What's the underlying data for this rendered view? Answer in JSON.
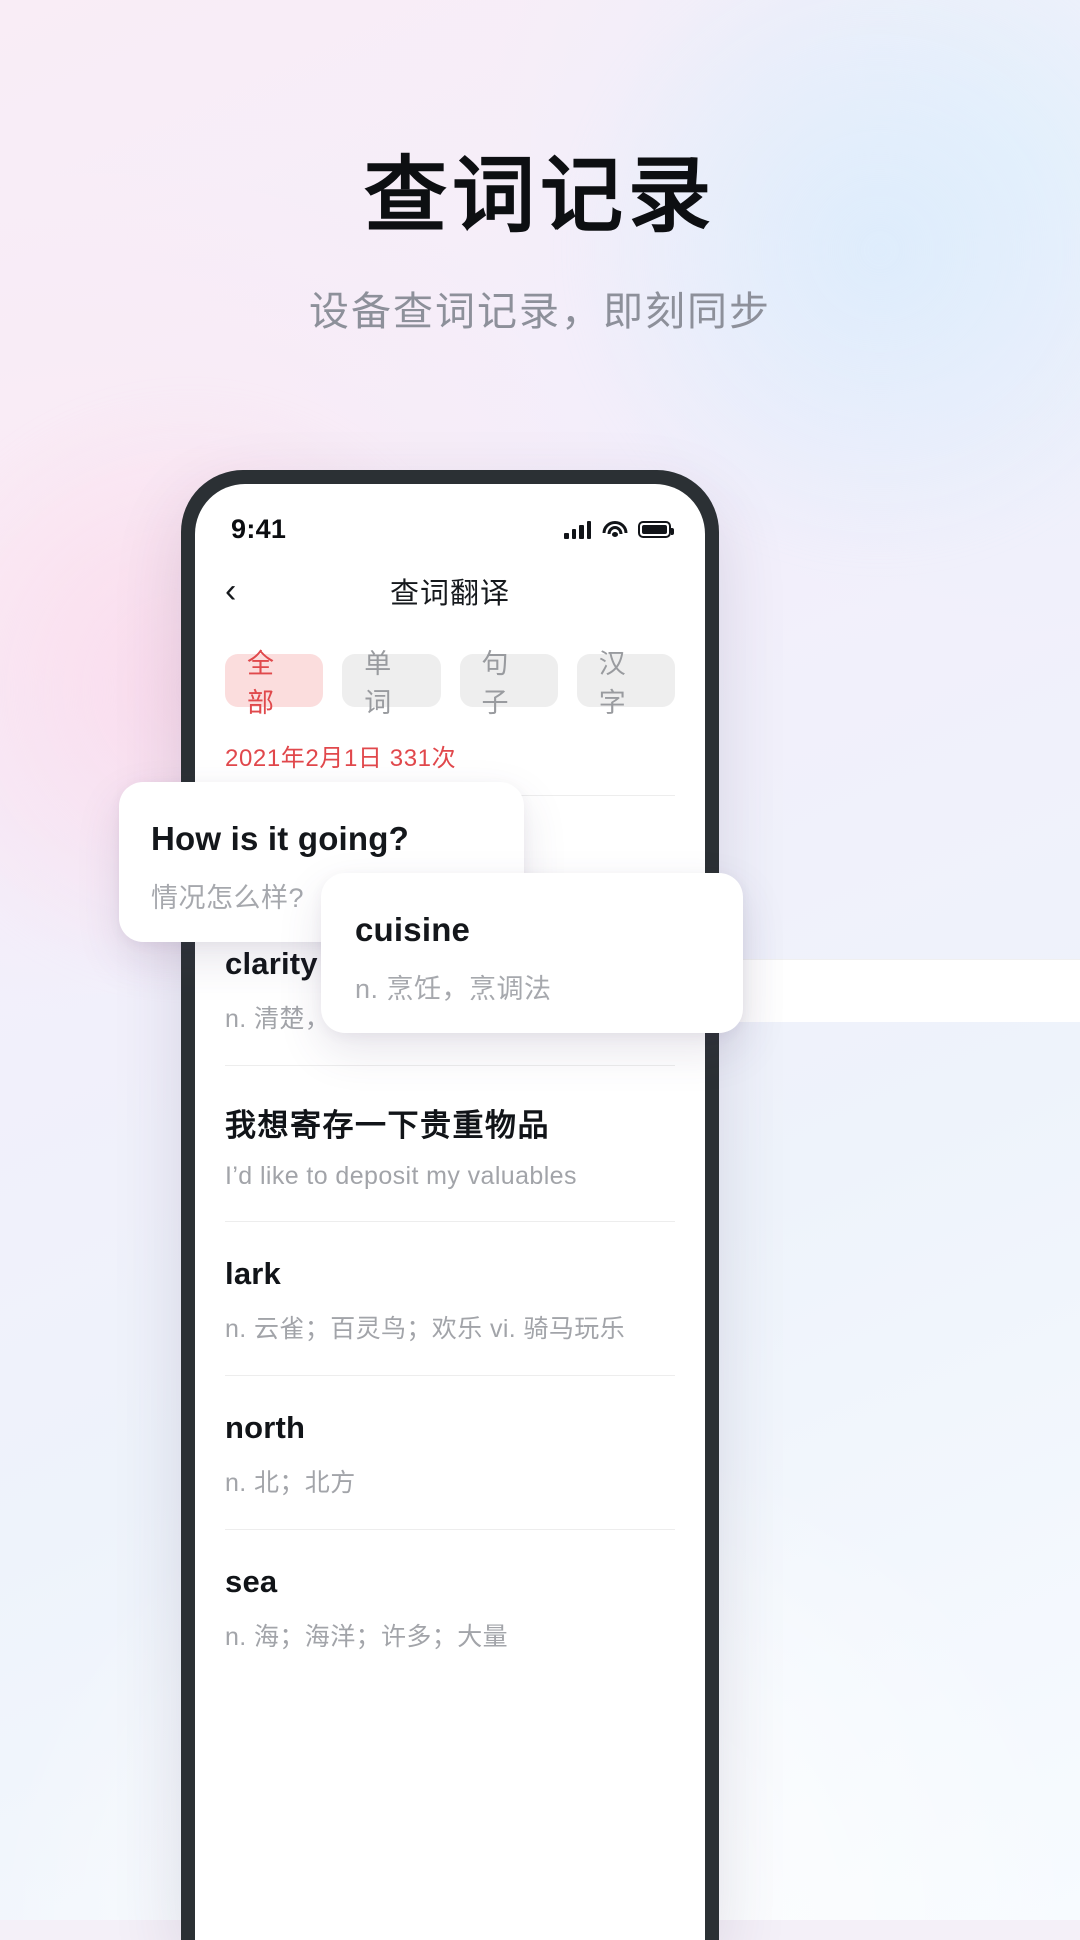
{
  "hero": {
    "title": "查词记录",
    "subtitle": "设备查词记录，即刻同步"
  },
  "colors": {
    "accent_red": "#e1484c",
    "chip_active_bg": "#fbdddd",
    "chip_bg": "#eeeeee",
    "text_primary": "#111418",
    "text_muted": "#a2a4a9"
  },
  "phone": {
    "status_bar": {
      "time": "9:41",
      "icons": [
        "signal-bars-icon",
        "wifi-icon",
        "battery-icon"
      ]
    },
    "nav": {
      "back_icon": "chevron-left-icon",
      "title": "查词翻译"
    },
    "filter_tabs": [
      {
        "label": "全部",
        "active": true
      },
      {
        "label": "单词",
        "active": false
      },
      {
        "label": "句子",
        "active": false
      },
      {
        "label": "汉字",
        "active": false
      }
    ],
    "date_group": {
      "label": "2021年2月1日 331次"
    },
    "entries": [
      {
        "term": "clarity",
        "meaning": "n. 清楚，明晰；透明  n. (Clarity)人名",
        "lang": "en"
      },
      {
        "term": "我想寄存一下贵重物品",
        "meaning": "I’d like to deposit my valuables",
        "lang": "zh"
      },
      {
        "term": "lark",
        "meaning": "n. 云雀；百灵鸟；欢乐  vi. 骑马玩乐",
        "lang": "en"
      },
      {
        "term": "north",
        "meaning": "n. 北；北方",
        "lang": "en"
      },
      {
        "term": "sea",
        "meaning": "n. 海；海洋；许多；大量",
        "lang": "en"
      }
    ]
  },
  "floating_cards": [
    {
      "term": "How is it going?",
      "meaning": "情况怎么样?"
    },
    {
      "term": "cuisine",
      "meaning": "n. 烹饪，烹调法"
    }
  ]
}
